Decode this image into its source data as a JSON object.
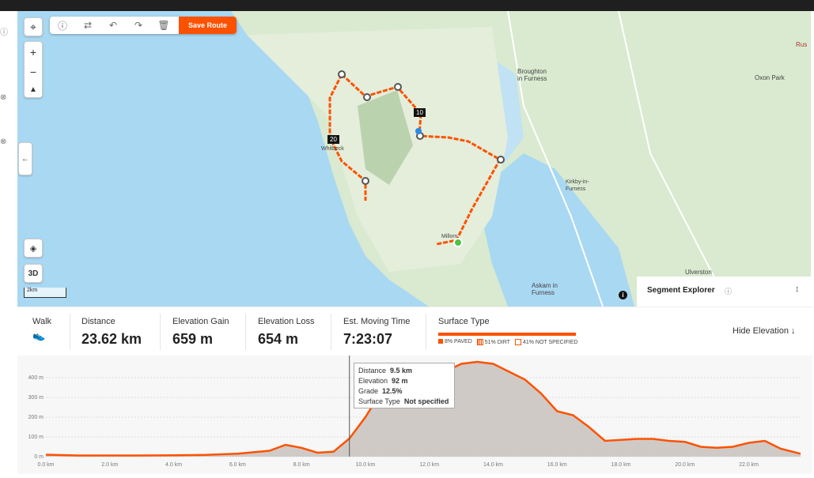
{
  "toolbar": {
    "save_label": "Save Route"
  },
  "map": {
    "labels": [
      {
        "name": "label-broughton",
        "text": "Broughton\nin Furness"
      },
      {
        "name": "label-oxon-park",
        "text": "Oxon Park"
      },
      {
        "name": "label-whitbeck",
        "text": "Whitbeck"
      },
      {
        "name": "label-kirkby",
        "text": "Kirkby-in-\nFurness"
      },
      {
        "name": "label-millom",
        "text": "Millom"
      },
      {
        "name": "label-askam",
        "text": "Askam in\nFurness"
      },
      {
        "name": "label-ulverston",
        "text": "Ulverston"
      },
      {
        "name": "label-rus",
        "text": "Rus"
      }
    ],
    "markers": [
      "10",
      "20"
    ],
    "scale_label": "2km",
    "view_3d_label": "3D",
    "segment_explorer_label": "Segment Explorer"
  },
  "stats": {
    "activity": "Walk",
    "distance_label": "Distance",
    "distance_value": "23.62 km",
    "gain_label": "Elevation Gain",
    "gain_value": "659 m",
    "loss_label": "Elevation Loss",
    "loss_value": "654 m",
    "time_label": "Est. Moving Time",
    "time_value": "7:23:07",
    "surface_label": "Surface Type",
    "surface_legend": [
      "8% PAVED",
      "51% DIRT",
      "41% NOT SPECIFIED"
    ],
    "hide_elevation": "Hide Elevation ↓"
  },
  "tooltip": {
    "distance_label": "Distance",
    "distance_value": "9.5 km",
    "elevation_label": "Elevation",
    "elevation_value": "92 m",
    "grade_label": "Grade",
    "grade_value": "12.5%",
    "surface_label": "Surface Type",
    "surface_value": "Not specified"
  },
  "colors": {
    "accent": "#fc5200",
    "water": "#a9d8f2",
    "land": "#d9ead0"
  },
  "chart_data": {
    "type": "area",
    "x": [
      0,
      1,
      2,
      3,
      4,
      5,
      6,
      7,
      7.5,
      8,
      8.5,
      9,
      9.5,
      10,
      10.5,
      11,
      11.5,
      12,
      12.5,
      13,
      13.5,
      14,
      14.5,
      15,
      15.5,
      16,
      16.5,
      17,
      17.5,
      18,
      18.5,
      19,
      19.5,
      20,
      20.5,
      21,
      21.5,
      22,
      22.5,
      23,
      23.62
    ],
    "values": [
      10,
      6,
      6,
      6,
      7,
      9,
      15,
      30,
      60,
      45,
      20,
      25,
      92,
      200,
      330,
      380,
      390,
      400,
      430,
      470,
      480,
      470,
      430,
      390,
      320,
      230,
      210,
      150,
      80,
      85,
      90,
      90,
      80,
      75,
      50,
      45,
      50,
      70,
      80,
      40,
      15
    ],
    "yticks": [
      "0 m",
      "100 m",
      "200 m",
      "300 m",
      "400 m"
    ],
    "xticks": [
      "0.0 km",
      "2.0 km",
      "4.0 km",
      "6.0 km",
      "8.0 km",
      "10.0 km",
      "12.0 km",
      "14.0 km",
      "16.0 km",
      "18.0 km",
      "20.0 km",
      "22.0 km"
    ],
    "ylim": [
      0,
      500
    ],
    "xlim": [
      0,
      23.62
    ],
    "grid": true
  }
}
